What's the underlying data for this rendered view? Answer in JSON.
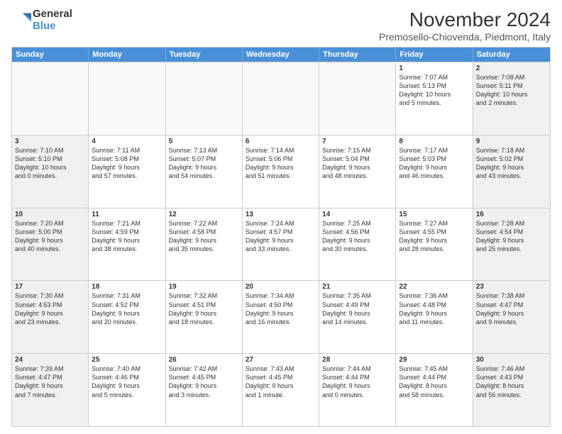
{
  "logo": {
    "general": "General",
    "blue": "Blue"
  },
  "title": "November 2024",
  "location": "Premosello-Chiovenda, Piedmont, Italy",
  "header_days": [
    "Sunday",
    "Monday",
    "Tuesday",
    "Wednesday",
    "Thursday",
    "Friday",
    "Saturday"
  ],
  "rows": [
    [
      {
        "num": "",
        "info": "",
        "empty": true
      },
      {
        "num": "",
        "info": "",
        "empty": true
      },
      {
        "num": "",
        "info": "",
        "empty": true
      },
      {
        "num": "",
        "info": "",
        "empty": true
      },
      {
        "num": "",
        "info": "",
        "empty": true
      },
      {
        "num": "1",
        "info": "Sunrise: 7:07 AM\nSunset: 5:13 PM\nDaylight: 10 hours\nand 5 minutes.",
        "empty": false
      },
      {
        "num": "2",
        "info": "Sunrise: 7:08 AM\nSunset: 5:11 PM\nDaylight: 10 hours\nand 2 minutes.",
        "empty": false
      }
    ],
    [
      {
        "num": "3",
        "info": "Sunrise: 7:10 AM\nSunset: 5:10 PM\nDaylight: 10 hours\nand 0 minutes.",
        "empty": false
      },
      {
        "num": "4",
        "info": "Sunrise: 7:11 AM\nSunset: 5:08 PM\nDaylight: 9 hours\nand 57 minutes.",
        "empty": false
      },
      {
        "num": "5",
        "info": "Sunrise: 7:13 AM\nSunset: 5:07 PM\nDaylight: 9 hours\nand 54 minutes.",
        "empty": false
      },
      {
        "num": "6",
        "info": "Sunrise: 7:14 AM\nSunset: 5:06 PM\nDaylight: 9 hours\nand 51 minutes.",
        "empty": false
      },
      {
        "num": "7",
        "info": "Sunrise: 7:15 AM\nSunset: 5:04 PM\nDaylight: 9 hours\nand 48 minutes.",
        "empty": false
      },
      {
        "num": "8",
        "info": "Sunrise: 7:17 AM\nSunset: 5:03 PM\nDaylight: 9 hours\nand 46 minutes.",
        "empty": false
      },
      {
        "num": "9",
        "info": "Sunrise: 7:18 AM\nSunset: 5:02 PM\nDaylight: 9 hours\nand 43 minutes.",
        "empty": false
      }
    ],
    [
      {
        "num": "10",
        "info": "Sunrise: 7:20 AM\nSunset: 5:00 PM\nDaylight: 9 hours\nand 40 minutes.",
        "empty": false
      },
      {
        "num": "11",
        "info": "Sunrise: 7:21 AM\nSunset: 4:59 PM\nDaylight: 9 hours\nand 38 minutes.",
        "empty": false
      },
      {
        "num": "12",
        "info": "Sunrise: 7:22 AM\nSunset: 4:58 PM\nDaylight: 9 hours\nand 35 minutes.",
        "empty": false
      },
      {
        "num": "13",
        "info": "Sunrise: 7:24 AM\nSunset: 4:57 PM\nDaylight: 9 hours\nand 33 minutes.",
        "empty": false
      },
      {
        "num": "14",
        "info": "Sunrise: 7:25 AM\nSunset: 4:56 PM\nDaylight: 9 hours\nand 30 minutes.",
        "empty": false
      },
      {
        "num": "15",
        "info": "Sunrise: 7:27 AM\nSunset: 4:55 PM\nDaylight: 9 hours\nand 28 minutes.",
        "empty": false
      },
      {
        "num": "16",
        "info": "Sunrise: 7:28 AM\nSunset: 4:54 PM\nDaylight: 9 hours\nand 25 minutes.",
        "empty": false
      }
    ],
    [
      {
        "num": "17",
        "info": "Sunrise: 7:30 AM\nSunset: 4:53 PM\nDaylight: 9 hours\nand 23 minutes.",
        "empty": false
      },
      {
        "num": "18",
        "info": "Sunrise: 7:31 AM\nSunset: 4:52 PM\nDaylight: 9 hours\nand 20 minutes.",
        "empty": false
      },
      {
        "num": "19",
        "info": "Sunrise: 7:32 AM\nSunset: 4:51 PM\nDaylight: 9 hours\nand 18 minutes.",
        "empty": false
      },
      {
        "num": "20",
        "info": "Sunrise: 7:34 AM\nSunset: 4:50 PM\nDaylight: 9 hours\nand 16 minutes.",
        "empty": false
      },
      {
        "num": "21",
        "info": "Sunrise: 7:35 AM\nSunset: 4:49 PM\nDaylight: 9 hours\nand 14 minutes.",
        "empty": false
      },
      {
        "num": "22",
        "info": "Sunrise: 7:36 AM\nSunset: 4:48 PM\nDaylight: 9 hours\nand 11 minutes.",
        "empty": false
      },
      {
        "num": "23",
        "info": "Sunrise: 7:38 AM\nSunset: 4:47 PM\nDaylight: 9 hours\nand 9 minutes.",
        "empty": false
      }
    ],
    [
      {
        "num": "24",
        "info": "Sunrise: 7:39 AM\nSunset: 4:47 PM\nDaylight: 9 hours\nand 7 minutes.",
        "empty": false
      },
      {
        "num": "25",
        "info": "Sunrise: 7:40 AM\nSunset: 4:46 PM\nDaylight: 9 hours\nand 5 minutes.",
        "empty": false
      },
      {
        "num": "26",
        "info": "Sunrise: 7:42 AM\nSunset: 4:45 PM\nDaylight: 9 hours\nand 3 minutes.",
        "empty": false
      },
      {
        "num": "27",
        "info": "Sunrise: 7:43 AM\nSunset: 4:45 PM\nDaylight: 9 hours\nand 1 minute.",
        "empty": false
      },
      {
        "num": "28",
        "info": "Sunrise: 7:44 AM\nSunset: 4:44 PM\nDaylight: 9 hours\nand 0 minutes.",
        "empty": false
      },
      {
        "num": "29",
        "info": "Sunrise: 7:45 AM\nSunset: 4:44 PM\nDaylight: 8 hours\nand 58 minutes.",
        "empty": false
      },
      {
        "num": "30",
        "info": "Sunrise: 7:46 AM\nSunset: 4:43 PM\nDaylight: 8 hours\nand 56 minutes.",
        "empty": false
      }
    ]
  ]
}
